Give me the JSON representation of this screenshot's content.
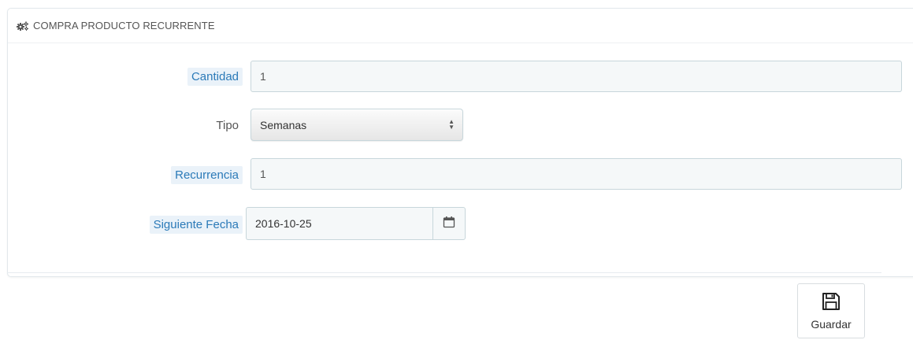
{
  "panel": {
    "title": "COMPRA PRODUCTO RECURRENTE",
    "title_icon": "cogs-icon"
  },
  "form": {
    "cantidad": {
      "label": "Cantidad",
      "value": "1"
    },
    "tipo": {
      "label": "Tipo",
      "selected": "Semanas"
    },
    "recurrencia": {
      "label": "Recurrencia",
      "value": "1"
    },
    "siguiente_fecha": {
      "label": "Siguiente Fecha",
      "value": "2016-10-25",
      "icon": "calendar-icon"
    }
  },
  "footer": {
    "save_label": "Guardar",
    "save_icon": "floppy-disk-icon"
  },
  "colors": {
    "hint_label_bg": "#eaf2f9",
    "hint_label_text": "#2b7ab8",
    "input_bg": "#f5f8f9",
    "input_border": "#c7d6db"
  }
}
